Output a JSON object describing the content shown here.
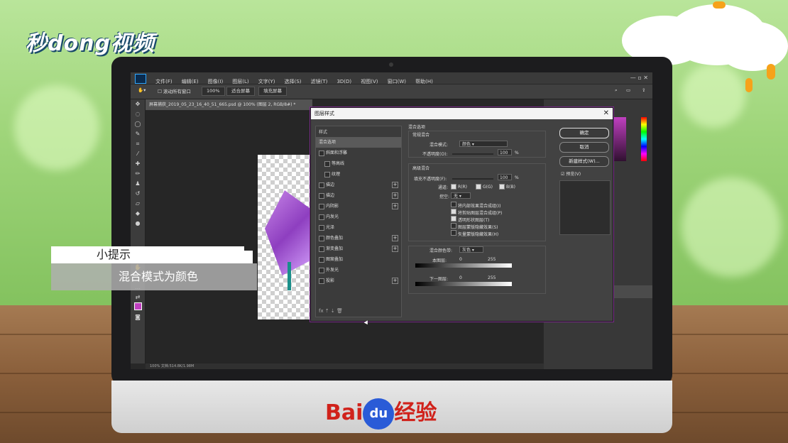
{
  "brand": {
    "logo_text": "秒dong视频",
    "baidu_prefix": "Bai",
    "baidu_paw": "du",
    "baidu_suffix": "经验"
  },
  "ps": {
    "menu": [
      "文件(F)",
      "编辑(E)",
      "图像(I)",
      "图层(L)",
      "文字(Y)",
      "选择(S)",
      "滤镜(T)",
      "3D(D)",
      "视图(V)",
      "窗口(W)",
      "帮助(H)"
    ],
    "options": {
      "scroll_all": "滚动所有窗口",
      "zoom": "100%",
      "fit_screen": "适合屏幕",
      "fill_screen": "填充屏幕"
    },
    "doc_tab": "屏幕捕获_2019_05_23_16_40_51_665.psd @ 100% (图层 2, RGB/8#) *",
    "status": {
      "zoom": "100%",
      "doc": "文档:514.8K/1.98M"
    }
  },
  "dialog": {
    "title": "图层样式",
    "styles_header": "样式",
    "styles": [
      {
        "label": "混合选项",
        "selected": true,
        "checkbox": false,
        "indent": false,
        "plus": false
      },
      {
        "label": "斜面和浮雕",
        "selected": false,
        "checkbox": true,
        "indent": false,
        "plus": false
      },
      {
        "label": "等高线",
        "selected": false,
        "checkbox": true,
        "indent": true,
        "plus": false
      },
      {
        "label": "纹理",
        "selected": false,
        "checkbox": true,
        "indent": true,
        "plus": false
      },
      {
        "label": "描边",
        "selected": false,
        "checkbox": true,
        "indent": false,
        "plus": true
      },
      {
        "label": "描边",
        "selected": false,
        "checkbox": true,
        "indent": false,
        "plus": true
      },
      {
        "label": "内阴影",
        "selected": false,
        "checkbox": true,
        "indent": false,
        "plus": true
      },
      {
        "label": "内发光",
        "selected": false,
        "checkbox": true,
        "indent": false,
        "plus": false
      },
      {
        "label": "光泽",
        "selected": false,
        "checkbox": true,
        "indent": false,
        "plus": false
      },
      {
        "label": "颜色叠加",
        "selected": false,
        "checkbox": true,
        "indent": false,
        "plus": true
      },
      {
        "label": "渐变叠加",
        "selected": false,
        "checkbox": true,
        "indent": false,
        "plus": true
      },
      {
        "label": "图案叠加",
        "selected": false,
        "checkbox": true,
        "indent": false,
        "plus": false
      },
      {
        "label": "外发光",
        "selected": false,
        "checkbox": true,
        "indent": false,
        "plus": false
      },
      {
        "label": "投影",
        "selected": false,
        "checkbox": true,
        "indent": false,
        "plus": true
      }
    ],
    "blend": {
      "section": "混合选项",
      "general": "常规混合",
      "blend_mode_label": "混合模式:",
      "blend_mode_value": "颜色",
      "opacity_label": "不透明度(O):",
      "opacity_value": "100",
      "percent": "%",
      "advanced": "高级混合",
      "fill_label": "填充不透明度(F):",
      "fill_value": "100",
      "channels_label": "通道:",
      "channel_r": "R(R)",
      "channel_g": "G(G)",
      "channel_b": "B(B)",
      "knockout_label": "挖空:",
      "knockout_value": "无",
      "opt1": "将内部效果混合成组(I)",
      "opt2": "将剪贴图层混合成组(P)",
      "opt3": "透明形状图层(T)",
      "opt4": "图层蒙版隐藏效果(S)",
      "opt5": "矢量蒙版隐藏效果(H)",
      "blend_if_label": "混合颜色带:",
      "blend_if_value": "灰色",
      "this_layer": "本图层:",
      "underlying": "下一图层:",
      "range_low": "0",
      "range_high": "255"
    },
    "buttons": {
      "ok": "确定",
      "cancel": "取消",
      "new_style": "新建样式(W)...",
      "preview": "预览(V)"
    }
  },
  "tip": {
    "title": "小提示",
    "body": "混合模式为颜色"
  },
  "colors": {
    "accent": "#1a8f8a",
    "gem": "#a050d0",
    "baidu_red": "#d0221b",
    "baidu_blue": "#2a5bd7"
  }
}
